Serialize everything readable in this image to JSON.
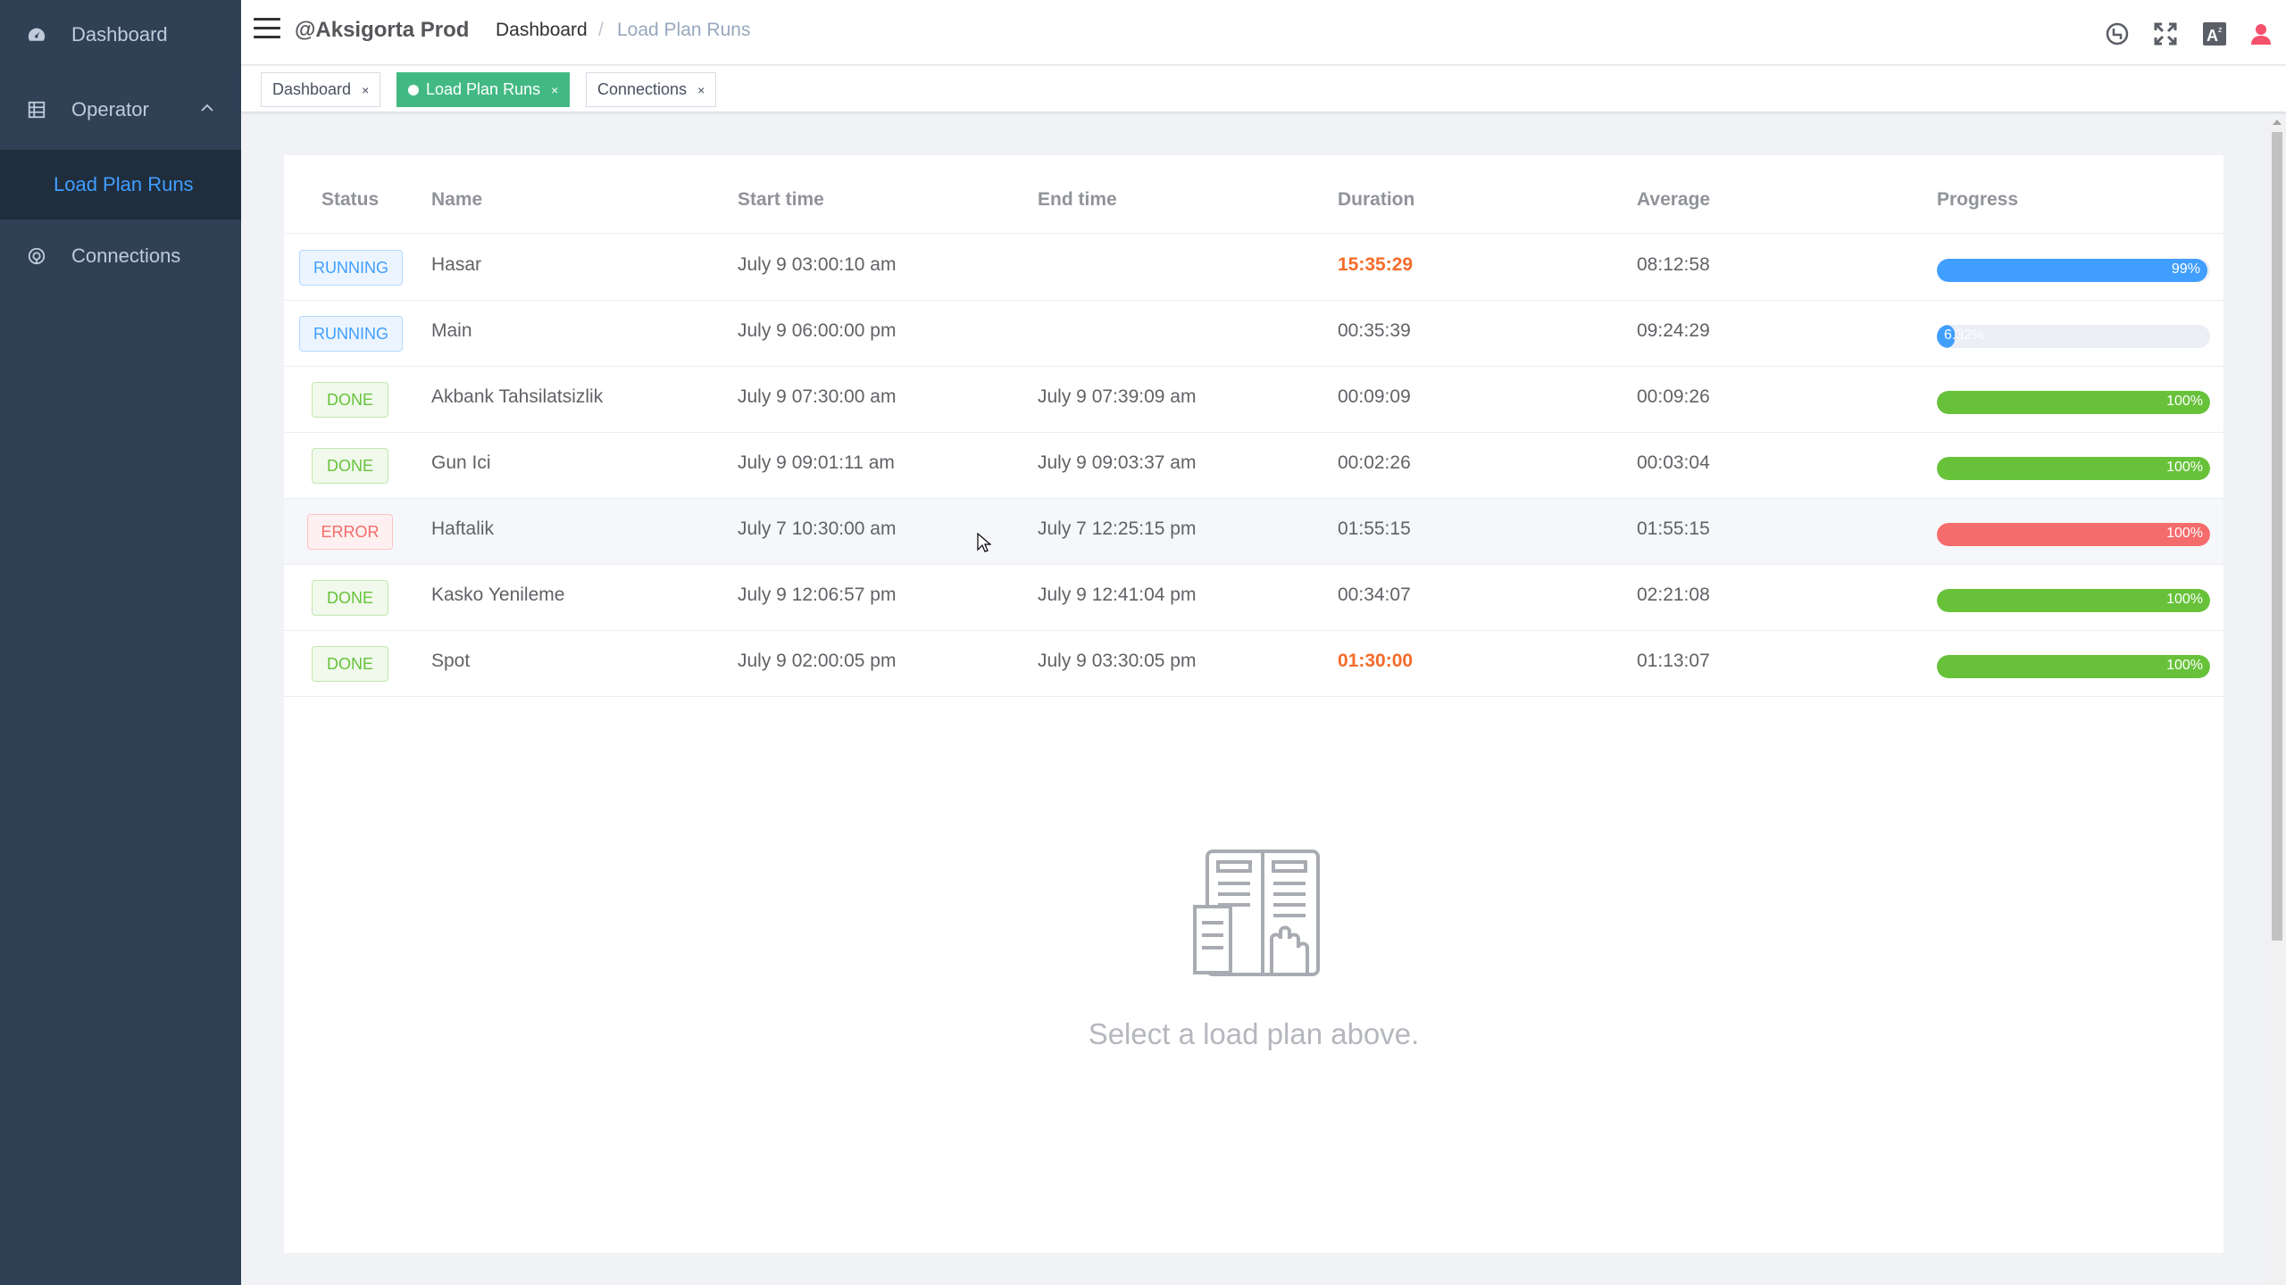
{
  "sidebar": {
    "items": [
      {
        "label": "Dashboard",
        "icon": "dashboard-icon"
      },
      {
        "label": "Operator",
        "icon": "table-icon",
        "expanded": true,
        "children": [
          {
            "label": "Load Plan Runs",
            "active": true
          }
        ]
      },
      {
        "label": "Connections",
        "icon": "connection-icon"
      }
    ]
  },
  "navbar": {
    "title": "@Aksigorta Prod",
    "breadcrumb": [
      "Dashboard",
      "Load Plan Runs"
    ],
    "breadcrumb_sep": "/",
    "icons": [
      "refresh-cycle-icon",
      "fullscreen-icon",
      "language-icon",
      "user-icon"
    ]
  },
  "tags": [
    {
      "label": "Dashboard",
      "active": false
    },
    {
      "label": "Load Plan Runs",
      "active": true
    },
    {
      "label": "Connections",
      "active": false
    }
  ],
  "tag_close": "×",
  "table": {
    "headers": [
      "Status",
      "Name",
      "Start time",
      "End time",
      "Duration",
      "Average",
      "Progress"
    ],
    "rows": [
      {
        "status": "RUNNING",
        "name": "Hasar",
        "start": "July 9 03:00:10 am",
        "end": "",
        "duration": "15:35:29",
        "duration_alert": true,
        "average": "08:12:58",
        "progress": 99,
        "progress_label": "99%"
      },
      {
        "status": "RUNNING",
        "name": "Main",
        "start": "July 9 06:00:00 pm",
        "end": "",
        "duration": "00:35:39",
        "duration_alert": false,
        "average": "09:24:29",
        "progress": 6.32,
        "progress_label": "6.32%"
      },
      {
        "status": "DONE",
        "name": "Akbank Tahsilatsizlik",
        "start": "July 9 07:30:00 am",
        "end": "July 9 07:39:09 am",
        "duration": "00:09:09",
        "duration_alert": false,
        "average": "00:09:26",
        "progress": 100,
        "progress_label": "100%"
      },
      {
        "status": "DONE",
        "name": "Gun Ici",
        "start": "July 9 09:01:11 am",
        "end": "July 9 09:03:37 am",
        "duration": "00:02:26",
        "duration_alert": false,
        "average": "00:03:04",
        "progress": 100,
        "progress_label": "100%"
      },
      {
        "status": "ERROR",
        "name": "Haftalik",
        "start": "July 7 10:30:00 am",
        "end": "July 7 12:25:15 pm",
        "duration": "01:55:15",
        "duration_alert": false,
        "average": "01:55:15",
        "progress": 100,
        "progress_label": "100%"
      },
      {
        "status": "DONE",
        "name": "Kasko Yenileme",
        "start": "July 9 12:06:57 pm",
        "end": "July 9 12:41:04 pm",
        "duration": "00:34:07",
        "duration_alert": false,
        "average": "02:21:08",
        "progress": 100,
        "progress_label": "100%"
      },
      {
        "status": "DONE",
        "name": "Spot",
        "start": "July 9 02:00:05 pm",
        "end": "July 9 03:30:05 pm",
        "duration": "01:30:00",
        "duration_alert": true,
        "average": "01:13:07",
        "progress": 100,
        "progress_label": "100%"
      }
    ]
  },
  "empty_state": {
    "text": "Select a load plan above.",
    "icon": "document-list-icon"
  },
  "colors": {
    "sidebar_bg": "#304156",
    "accent": "#409eff",
    "tag_active": "#42b983",
    "done": "#67c23a",
    "error": "#f56c6c",
    "alert": "#f56c2a"
  }
}
